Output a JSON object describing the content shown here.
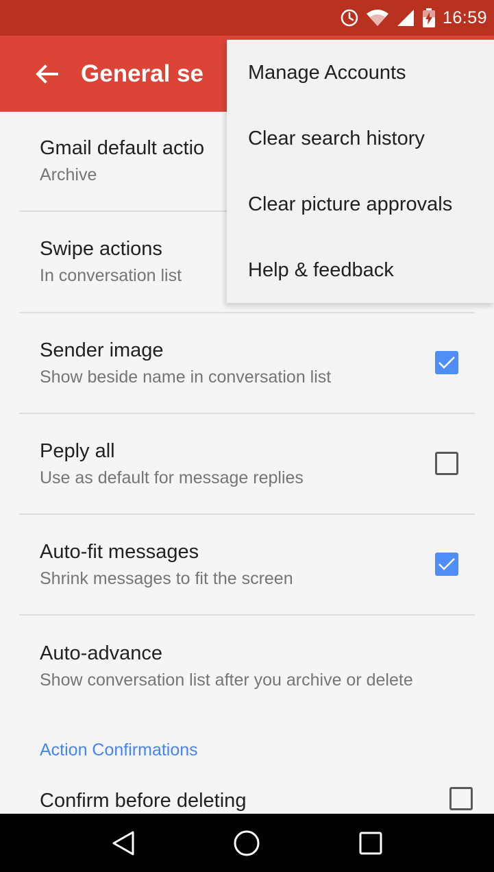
{
  "status_bar": {
    "time": "16:59",
    "icons": [
      "alarm-icon",
      "wifi-icon",
      "signal-icon",
      "battery-charging-icon"
    ]
  },
  "app_bar": {
    "title": "General se",
    "back_icon": "arrow-back-icon"
  },
  "settings": [
    {
      "title": "Gmail default actio",
      "subtitle": "Archive"
    },
    {
      "title": "Swipe actions",
      "subtitle": "In conversation list"
    },
    {
      "title": "Sender image",
      "subtitle": "Show beside name in conversation list",
      "checked": true
    },
    {
      "title": "Peply all",
      "subtitle": "Use as default for message replies",
      "checked": false
    },
    {
      "title": "Auto-fit messages",
      "subtitle": "Shrink messages to fit the screen",
      "checked": true
    },
    {
      "title": "Auto-advance",
      "subtitle": "Show conversation list after you archive or delete"
    }
  ],
  "section_header": "Action Confirmations",
  "confirm_row": {
    "title": "Confirm before deleting",
    "checked": false
  },
  "overflow_menu": {
    "items": [
      "Manage Accounts",
      "Clear search history",
      "Clear picture approvals",
      "Help & feedback"
    ]
  },
  "nav_bar": {
    "icons": [
      "back-triangle-icon",
      "home-circle-icon",
      "recents-square-icon"
    ]
  },
  "colors": {
    "status_bar": "#b93220",
    "app_bar": "#db4437",
    "accent": "#4285f4",
    "checkbox_checked": "#4f8ef7"
  }
}
